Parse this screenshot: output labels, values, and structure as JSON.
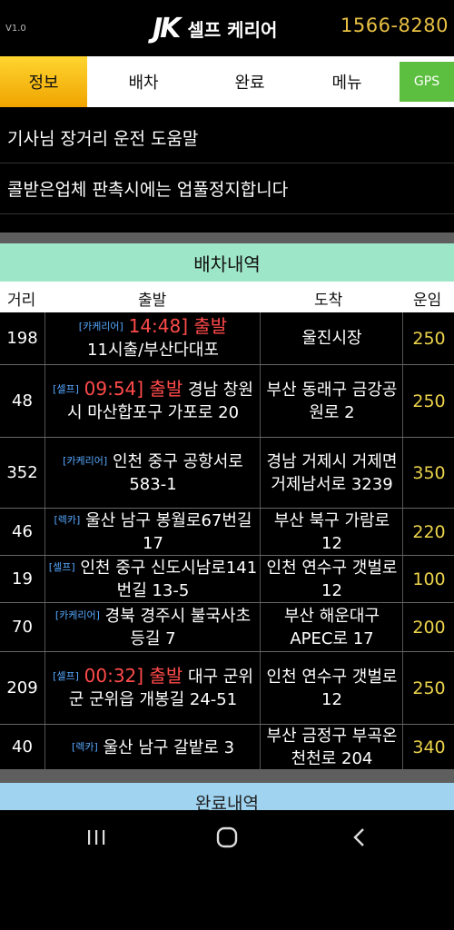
{
  "header": {
    "version": "V1.0",
    "logo_mark": "JK",
    "logo_text": "셀프 케리어",
    "phone": "1566-8280"
  },
  "tabs": [
    {
      "label": "정보",
      "active": true
    },
    {
      "label": "배차"
    },
    {
      "label": "완료"
    },
    {
      "label": "메뉴"
    },
    {
      "label": "GPS"
    }
  ],
  "notices": [
    "기사님 장거리 운전 도움말",
    "콜받은업체 판촉시에는 업풀정지합니다"
  ],
  "dispatch": {
    "title": "배차내역",
    "columns": [
      "거리",
      "출발",
      "도착",
      "운임"
    ],
    "rows": [
      {
        "distance": "198",
        "tag": "[카케리어]",
        "time": "14:48] 출발",
        "origin": "11시출/부산다대포",
        "destination": "울진시장",
        "fare": "250"
      },
      {
        "distance": "48",
        "tag": "[셀프]",
        "time": "09:54] 출발",
        "origin": "경남 창원시 마산합포구 가포로 20",
        "destination": "부산 동래구 금강공원로 2",
        "fare": "250"
      },
      {
        "distance": "352",
        "tag": "[카케리어]",
        "time": "",
        "origin": "인천 중구 공항서로 583-1",
        "destination": "경남 거제시 거제면 거제남서로 3239",
        "fare": "350"
      },
      {
        "distance": "46",
        "tag": "[렉카]",
        "time": "",
        "origin": "울산 남구 봉월로67번길 17",
        "destination": "부산 북구 가람로 12",
        "fare": "220"
      },
      {
        "distance": "19",
        "tag": "[셀프]",
        "time": "",
        "origin": "인천 중구 신도시남로141번길 13-5",
        "destination": "인천 연수구 갯벌로 12",
        "fare": "100"
      },
      {
        "distance": "70",
        "tag": "[카케리어]",
        "time": "",
        "origin": "경북 경주시 불국사초등길 7",
        "destination": "부산 해운대구 APEC로 17",
        "fare": "200"
      },
      {
        "distance": "209",
        "tag": "[셀프]",
        "time": "00:32] 출발",
        "origin": "대구 군위군 군위읍 개봉길 24-51",
        "destination": "인천 연수구 갯벌로 12",
        "fare": "250"
      },
      {
        "distance": "40",
        "tag": "[렉카]",
        "time": "",
        "origin": "울산 남구 갈밭로 3",
        "destination": "부산 금정구 부곡온천천로 204",
        "fare": "340"
      }
    ]
  },
  "complete": {
    "title": "완료내역"
  },
  "colors": {
    "accent_yellow": "#f0a400",
    "fare_yellow": "#ecd34a",
    "time_red": "#ff4a4a",
    "tag_blue": "#55a8ff",
    "section_green": "#9ee6c8",
    "gps_green": "#5cbf3f"
  },
  "icons": {
    "recent": "recent-apps-icon",
    "home": "home-icon",
    "back": "back-icon"
  }
}
